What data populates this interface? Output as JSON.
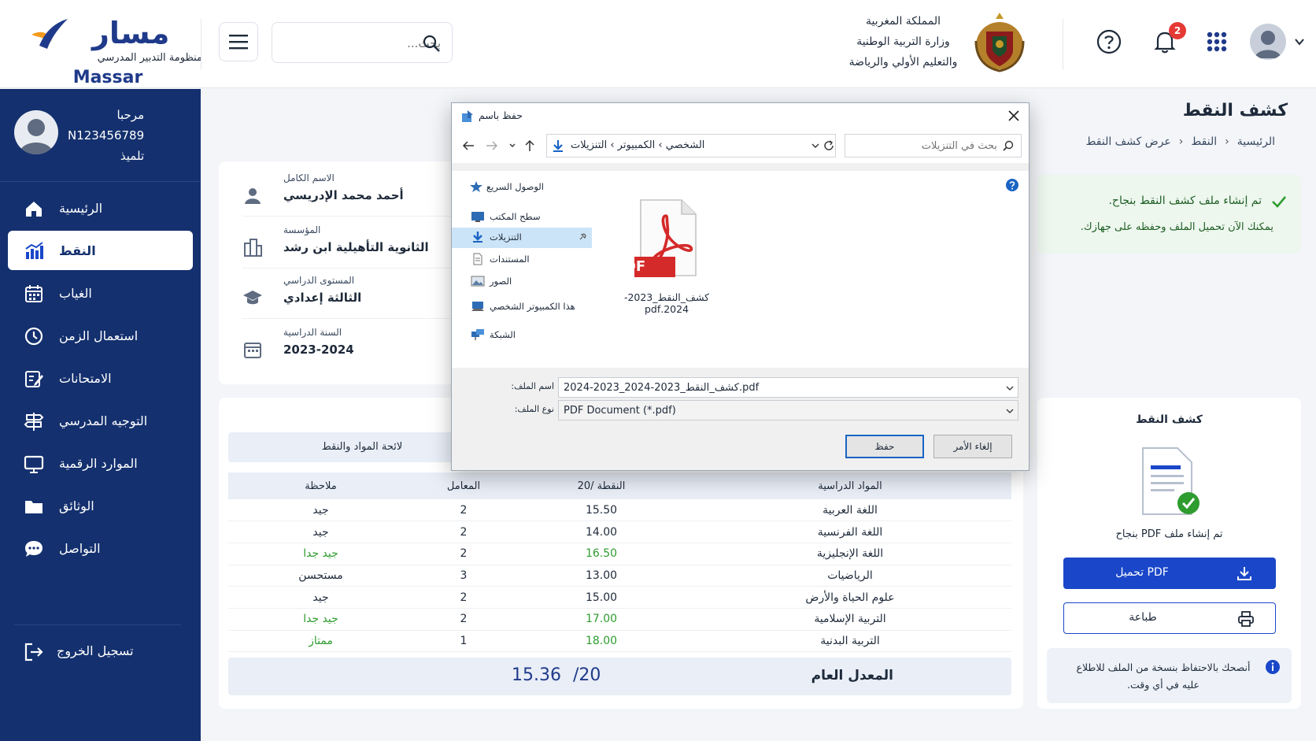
{
  "header": {
    "logo_ar": "مسار",
    "logo_sub": "منظومة التدبير المدرسي",
    "logo_en": "Massar",
    "search_placeholder": "بحث...",
    "ministry_line1": "المملكة المغربية",
    "ministry_line2": "وزارة التربية الوطنية",
    "ministry_line3": "والتعليم الأولي والرياضة",
    "notifications_count": "2"
  },
  "sidebar": {
    "greeting": "مرحبا",
    "user_id": "N123456789",
    "role": "تلميذ",
    "items": [
      {
        "label": "الرئيسية",
        "icon": "home-icon"
      },
      {
        "label": "النقط",
        "icon": "chart-icon",
        "active": true
      },
      {
        "label": "الغياب",
        "icon": "calendar-icon"
      },
      {
        "label": "استعمال الزمن",
        "icon": "clock-icon"
      },
      {
        "label": "الامتحانات",
        "icon": "exam-icon"
      },
      {
        "label": "التوجيه المدرسي",
        "icon": "signpost-icon"
      },
      {
        "label": "الموارد الرقمية",
        "icon": "monitor-icon"
      },
      {
        "label": "الوثائق",
        "icon": "folder-icon"
      },
      {
        "label": "التواصل",
        "icon": "chat-icon"
      }
    ],
    "logout": "تسجيل الخروج"
  },
  "page": {
    "title": "كشف النقط",
    "breadcrumb": [
      "الرئيسية",
      "النقط",
      "عرض كشف النقط"
    ]
  },
  "student": {
    "name_label": "الاسم الكامل",
    "name": "أحمد محمد الإدريسي",
    "school_label": "المؤسسة",
    "school": "الثانوية التأهيلية ابن رشد",
    "level_label": "المستوى الدراسي",
    "level": "الثالثة إعدادي",
    "year_label": "السنة الدراسية",
    "year": "2023-2024"
  },
  "grades": {
    "tab_label": "لائحة المواد والنقط",
    "columns": [
      "المواد الدراسية",
      "النقطة /20",
      "المعامل",
      "ملاحظة"
    ],
    "rows": [
      {
        "subject": "اللغة العربية",
        "grade": "15.50",
        "coef": "2",
        "note": "جيد",
        "highlight": false
      },
      {
        "subject": "اللغة الفرنسية",
        "grade": "14.00",
        "coef": "2",
        "note": "جيد",
        "highlight": false
      },
      {
        "subject": "اللغة الإنجليزية",
        "grade": "16.50",
        "coef": "2",
        "note": "جيد جدا",
        "highlight": true
      },
      {
        "subject": "الرياضيات",
        "grade": "13.00",
        "coef": "3",
        "note": "مستحسن",
        "highlight": false
      },
      {
        "subject": "علوم الحياة والأرض",
        "grade": "15.00",
        "coef": "2",
        "note": "جيد",
        "highlight": false
      },
      {
        "subject": "التربية الإسلامية",
        "grade": "17.00",
        "coef": "2",
        "note": "جيد جدا",
        "highlight": true
      },
      {
        "subject": "التربية البدنية",
        "grade": "18.00",
        "coef": "1",
        "note": "ممتاز",
        "highlight": true
      }
    ],
    "average_label": "المعدل العام",
    "average_value": "15.36",
    "average_scale": "/20"
  },
  "success": {
    "line1": "تم إنشاء ملف كشف النقط بنجاح.",
    "line2": "يمكنك الآن تحميل الملف وحفظه على جهازك."
  },
  "pdf_panel": {
    "title": "كشف النقط",
    "status": "تم إنشاء ملف PDF بنجاح",
    "download_label": "تحميل PDF",
    "print_label": "طباعة",
    "tip": "أنصحك بالاحتفاظ بنسخة من الملف للاطلاع عليه في أي وقت."
  },
  "dialog": {
    "title": "حفظ باسم",
    "path": "الشخصي  ›  الكمبيوتر  ›  التنزيلات",
    "search_placeholder": "بحث في التنزيلات",
    "tree": [
      "الوصول السريع",
      "سطح المكتب",
      "التنزيلات",
      "المستندات",
      "الصور",
      "هذا الكمبيوتر الشخصي",
      "الشبكة"
    ],
    "file_name": "كشف_النقط_2023-2024.pdf",
    "filename_label": "اسم الملف:",
    "filename_value": "كشف_النقط_2023-2024_2023-2024.pdf",
    "filetype_label": "نوع الملف:",
    "filetype_value": "PDF Document (*.pdf)",
    "save_label": "حفظ",
    "cancel_label": "إلغاء الأمر"
  },
  "colors": {
    "sidebar": "#14306e",
    "primary": "#1a47c9",
    "success": "#2e9c2e",
    "badge": "#e53935"
  }
}
